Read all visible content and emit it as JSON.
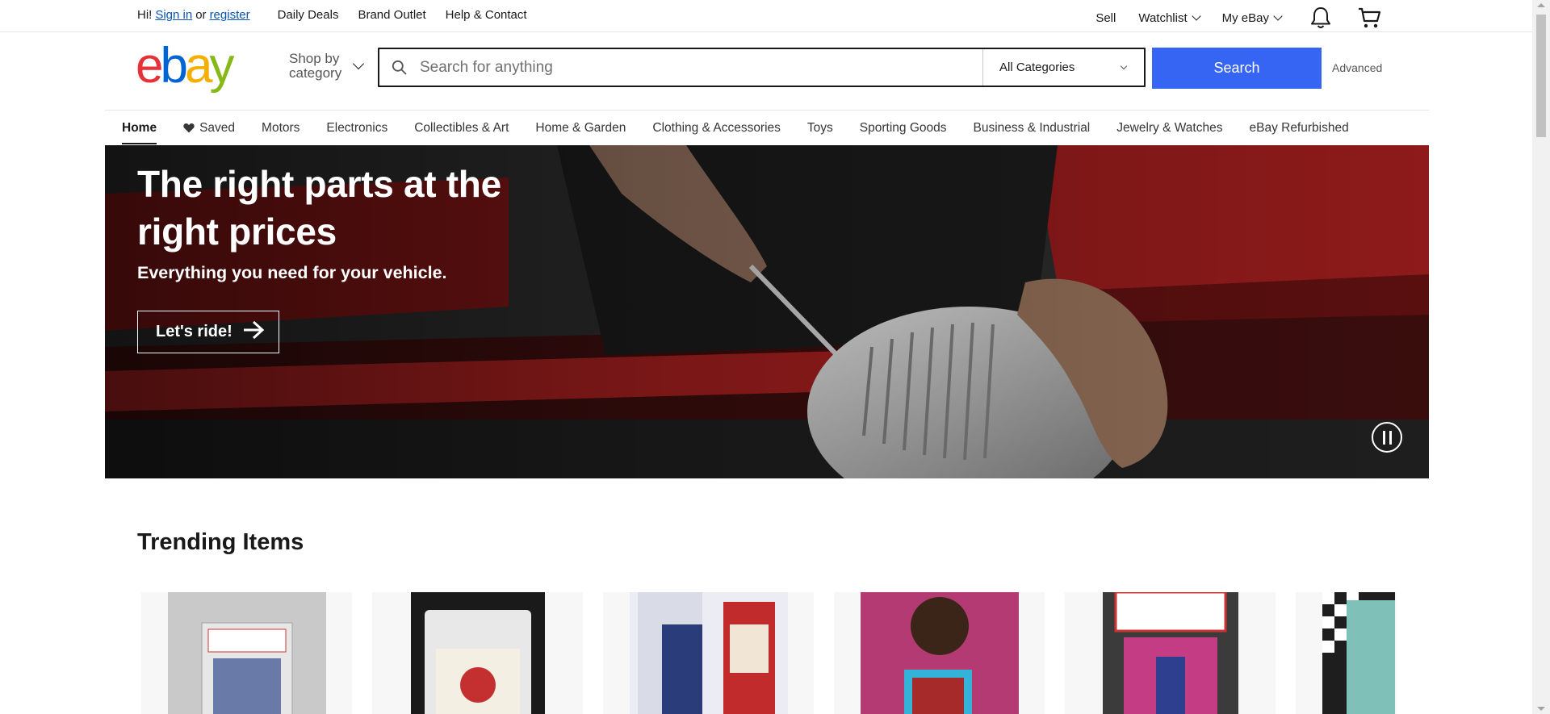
{
  "topbar": {
    "greeting_prefix": "Hi!",
    "sign_in": "Sign in",
    "or": "or",
    "register": "register",
    "links": [
      "Daily Deals",
      "Brand Outlet",
      "Help & Contact"
    ],
    "sell": "Sell",
    "watchlist": "Watchlist",
    "my_ebay": "My eBay",
    "icons": [
      "bell-icon",
      "cart-icon"
    ]
  },
  "header": {
    "logo_letters": [
      "e",
      "b",
      "a",
      "y"
    ],
    "logo_colors": [
      "#e53238",
      "#0064d2",
      "#f5af02",
      "#86b817"
    ],
    "shop_by_line1": "Shop by",
    "shop_by_line2": "category",
    "search_placeholder": "Search for anything",
    "category_selected": "All Categories",
    "search_button": "Search",
    "advanced": "Advanced",
    "accent_color": "#3665f3"
  },
  "nav": {
    "items": [
      "Home",
      "Saved",
      "Motors",
      "Electronics",
      "Collectibles & Art",
      "Home & Garden",
      "Clothing & Accessories",
      "Toys",
      "Sporting Goods",
      "Business & Industrial",
      "Jewelry & Watches",
      "eBay Refurbished"
    ],
    "active": "Home"
  },
  "hero": {
    "title": "The right parts at the right prices",
    "subtitle": "Everything you need for your vehicle.",
    "cta": "Let's ride!",
    "pause_icon": "pause-icon"
  },
  "trending": {
    "title": "Trending Items",
    "card_count": 6
  }
}
